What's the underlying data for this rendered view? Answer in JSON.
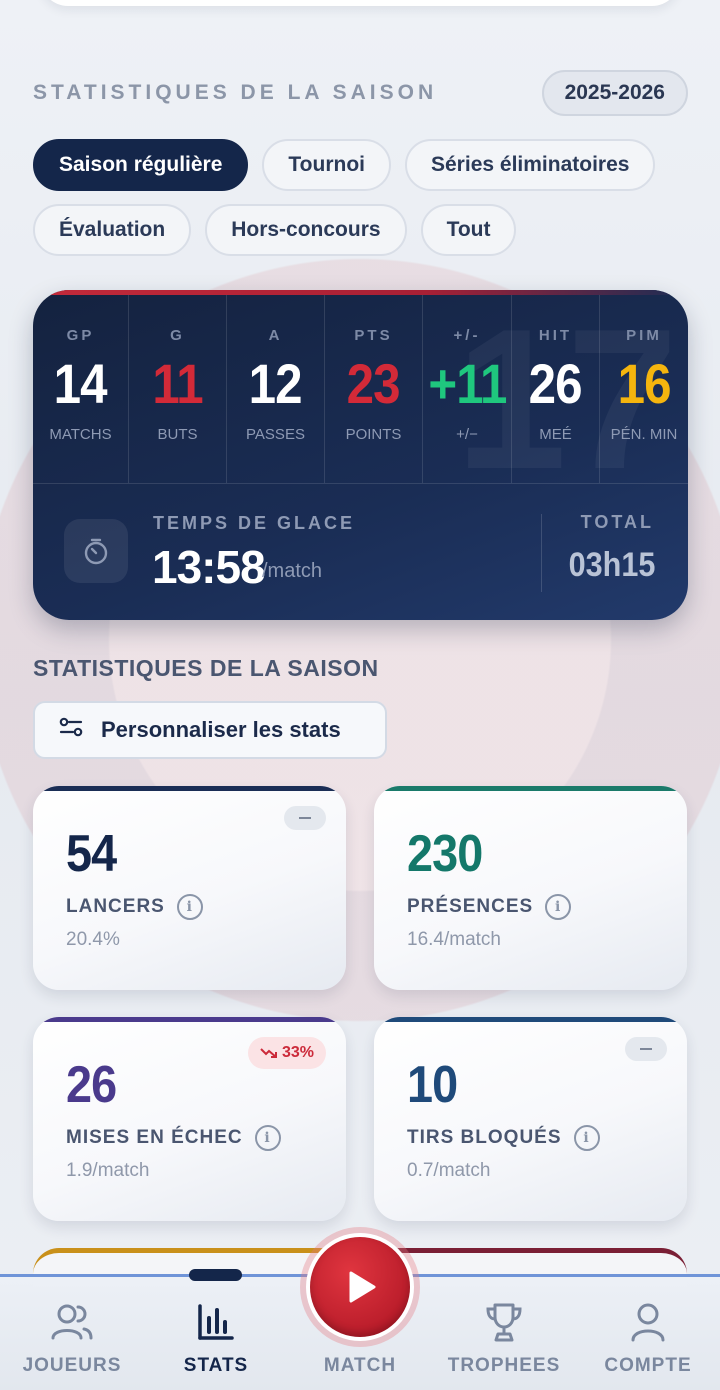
{
  "header": {
    "title": "STATISTIQUES DE LA SAISON",
    "season": "2025-2026"
  },
  "filters": [
    {
      "label": "Saison régulière",
      "active": true
    },
    {
      "label": "Tournoi",
      "active": false
    },
    {
      "label": "Séries éliminatoires",
      "active": false
    },
    {
      "label": "Évaluation",
      "active": false
    },
    {
      "label": "Hors-concours",
      "active": false
    },
    {
      "label": "Tout",
      "active": false
    }
  ],
  "summary": {
    "jersey_number": "17",
    "stats": [
      {
        "abbr": "GP",
        "value": "14",
        "label": "MATCHS",
        "color": "#ffffff"
      },
      {
        "abbr": "G",
        "value": "11",
        "label": "BUTS",
        "color": "#d32a38"
      },
      {
        "abbr": "A",
        "value": "12",
        "label": "PASSES",
        "color": "#ffffff"
      },
      {
        "abbr": "PTS",
        "value": "23",
        "label": "POINTS",
        "color": "#d32a38"
      },
      {
        "abbr": "+/-",
        "value": "+11",
        "label": "+/−",
        "color": "#1fc77e"
      },
      {
        "abbr": "HIT",
        "value": "26",
        "label": "MEÉ",
        "color": "#ffffff"
      },
      {
        "abbr": "PIM",
        "value": "16",
        "label": "PÉN. MIN",
        "color": "#f5b50e"
      }
    ],
    "ice_time": {
      "title": "TEMPS DE GLACE",
      "value": "13:58",
      "unit": "/match",
      "total_label": "TOTAL",
      "total_value": "03h15"
    }
  },
  "section2": {
    "title": "STATISTIQUES DE LA SAISON",
    "customize_label": "Personnaliser les stats"
  },
  "tiles": [
    {
      "value": "54",
      "label": "LANCERS",
      "sub": "20.4%",
      "color": "#14264a",
      "bar": "#1a2d55",
      "trend": "flat"
    },
    {
      "value": "230",
      "label": "PRÉSENCES",
      "sub": "16.4/match",
      "color": "#14786a",
      "bar": "#1a7a6a",
      "trend": "none"
    },
    {
      "value": "26",
      "label": "MISES EN ÉCHEC",
      "sub": "1.9/match",
      "color": "#4a3a8c",
      "bar": "#4a3a8c",
      "trend": "down",
      "trend_text": "33%"
    },
    {
      "value": "10",
      "label": "TIRS BLOQUÉS",
      "sub": "0.7/match",
      "color": "#1f4a7a",
      "bar": "#1f4a7a",
      "trend": "flat"
    }
  ],
  "nav": [
    {
      "label": "JOUEURS",
      "icon": "users-icon"
    },
    {
      "label": "STATS",
      "icon": "bar-chart-icon",
      "active": true
    },
    {
      "label": "MATCH",
      "icon": "play-icon"
    },
    {
      "label": "TROPHEES",
      "icon": "trophy-icon"
    },
    {
      "label": "COMPTE",
      "icon": "user-icon"
    }
  ]
}
